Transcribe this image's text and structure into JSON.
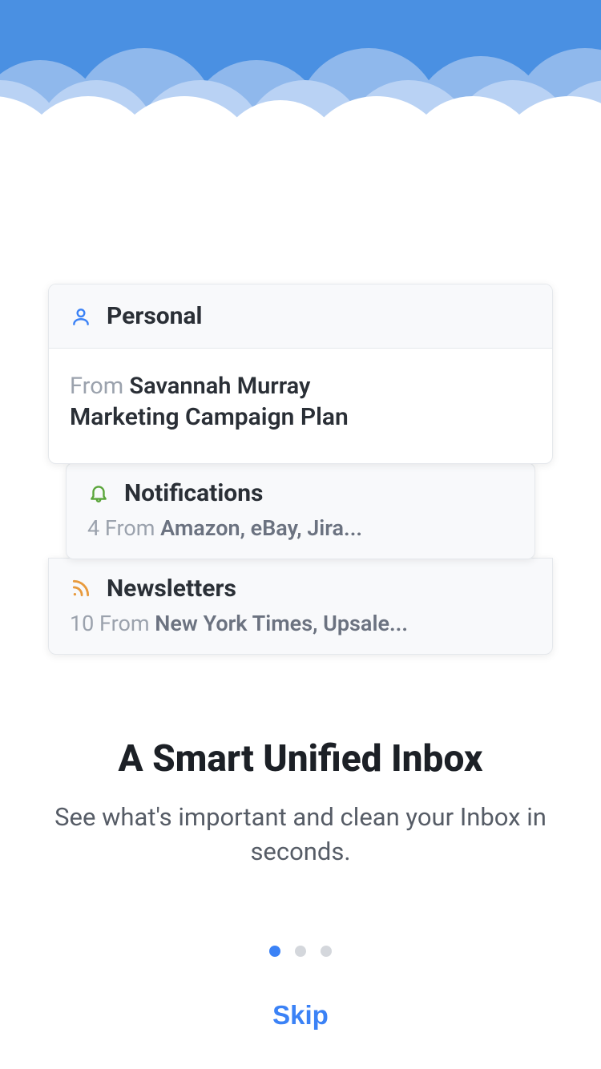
{
  "cards": {
    "personal": {
      "title": "Personal",
      "from_prefix": "From ",
      "sender": "Savannah Murray",
      "subject": "Marketing Campaign Plan"
    },
    "notifications": {
      "title": "Notifications",
      "count_prefix": "4 From ",
      "sources": "Amazon, eBay, Jira..."
    },
    "newsletters": {
      "title": "Newsletters",
      "count_prefix": "10 From ",
      "sources": "New York Times, Upsale..."
    }
  },
  "headline": {
    "title": "A Smart Unified Inbox",
    "subtitle": "See what's important and clean your Inbox in seconds."
  },
  "pager": {
    "count": 3,
    "active": 0
  },
  "skip_label": "Skip",
  "colors": {
    "sky": "#4a90e2",
    "person_icon": "#3b82f6",
    "bell_icon": "#5aa53a",
    "rss_icon": "#e89a3c"
  }
}
